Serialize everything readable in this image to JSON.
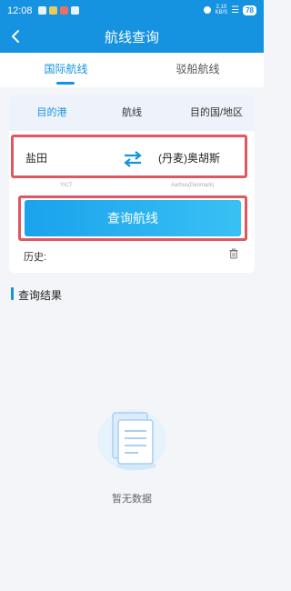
{
  "status_bar": {
    "time": "12:08",
    "net_speed_value": "2.10",
    "net_speed_unit": "KB/S",
    "battery": "78"
  },
  "header": {
    "title": "航线查询"
  },
  "main_tabs": [
    {
      "label": "国际航线",
      "active": true
    },
    {
      "label": "驳船航线",
      "active": false
    }
  ],
  "sub_tabs": [
    {
      "label": "目的港",
      "active": true
    },
    {
      "label": "航线",
      "active": false
    },
    {
      "label": "目的国/地区",
      "active": false
    }
  ],
  "route": {
    "origin": {
      "name": "盐田",
      "code": "YICT"
    },
    "destination": {
      "name": "(丹麦)奥胡斯",
      "code": "Aarhus(Denmark)"
    }
  },
  "query_button_label": "查询航线",
  "history_label": "历史:",
  "results": {
    "title": "查询结果",
    "empty_text": "暂无数据"
  },
  "colors": {
    "primary": "#1592e0",
    "highlight_border": "#e1565f"
  },
  "icons": [
    "back-icon",
    "swap-icon",
    "trash-icon",
    "empty-document-icon"
  ]
}
